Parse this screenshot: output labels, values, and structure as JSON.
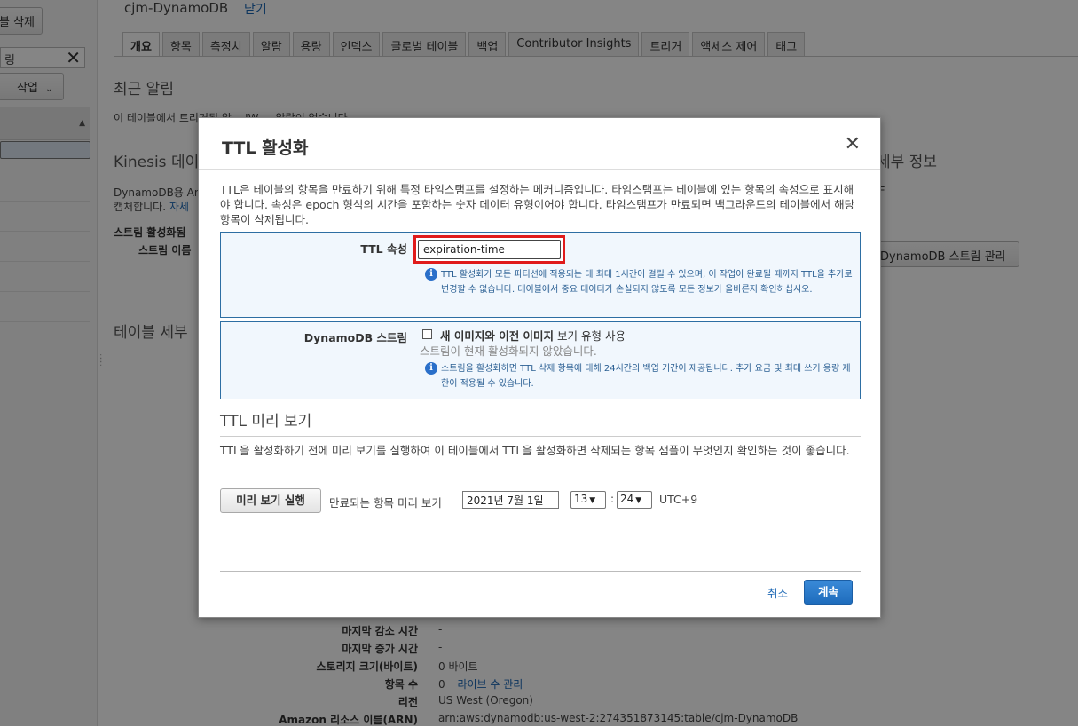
{
  "left": {
    "delete_button": "블 삭제",
    "search_value": "링",
    "actions_button": "작업"
  },
  "main": {
    "table_name": "cjm-DynamoDB",
    "close_link": "닫기",
    "tabs": [
      "개요",
      "항목",
      "측정치",
      "알람",
      "용량",
      "인덱스",
      "글로벌 테이블",
      "백업",
      "Contributor Insights",
      "트리거",
      "액세스 제어",
      "태그"
    ],
    "recent_alarms_heading": "최근 알림",
    "recent_alarms_text": "이 테이블에서 트리거된 알... JW ... 알람이 없습니다.",
    "kinesis_heading": "Kinesis 데이",
    "kinesis_text_1": "DynamoDB용 An",
    "kinesis_text_2": "캡처합니다.",
    "kinesis_link": "자세",
    "stream_label_1": "스트림 활성화됨",
    "stream_label_2": "스트림 이름",
    "details_heading_right": "세부 정보",
    "details_text_right": "E",
    "manage_stream_button": "DynamoDB 스트림 관리",
    "table_details_heading": "테이블 세부",
    "details_rows": [
      {
        "label": "마지막 감소 시간",
        "value": "-"
      },
      {
        "label": "마지막 증가 시간",
        "value": "-"
      },
      {
        "label": "스토리지 크기(바이트)",
        "value": "0 바이트"
      },
      {
        "label": "항목 수",
        "value": "0",
        "link": "라이브 수 관리"
      },
      {
        "label": "리전",
        "value": "US West (Oregon)"
      },
      {
        "label": "Amazon 리소스 이름(ARN)",
        "value": "arn:aws:dynamodb:us-west-2:274351873145:table/cjm-DynamoDB"
      }
    ]
  },
  "modal": {
    "title": "TTL 활성화",
    "description": "TTL은 테이블의 항목을 만료하기 위해 특정 타임스탬프를 설정하는 메커니즘입니다. 타임스탬프는 테이블에 있는 항목의 속성으로 표시해야 합니다. 속성은 epoch 형식의 시간을 포함하는 숫자 데이터 유형이어야 합니다. 타임스탬프가 만료되면 백그라운드의 테이블에서 해당 항목이 삭제됩니다.",
    "ttl_attribute_label": "TTL 속성",
    "ttl_attribute_value": "expiration-time",
    "ttl_info": "TTL 활성화가 모든 파티션에 적용되는 데 최대 1시간이 걸릴 수 있으며, 이 작업이 완료될 때까지 TTL을 추가로 변경할 수 없습니다. 테이블에서 중요 데이터가 손실되지 않도록 모든 정보가 올바른지 확인하십시오.",
    "stream_label": "DynamoDB 스트림",
    "stream_checkbox_bold": "새 이미지와 이전 이미지",
    "stream_checkbox_rest": "보기 유형 사용",
    "stream_status": "스트림이 현재 활성화되지 않았습니다.",
    "stream_info": "스트림을 활성화하면 TTL 삭제 항목에 대해 24시간의 백업 기간이 제공됩니다. 추가 요금 및 최대 쓰기 용량 제한이 적용될 수 있습니다.",
    "preview_heading": "TTL 미리 보기",
    "preview_description": "TTL을 활성화하기 전에 미리 보기를 실행하여 이 테이블에서 TTL을 활성화하면 삭제되는 항목 샘플이 무엇인지 확인하는 것이 좋습니다.",
    "run_preview_button": "미리 보기 실행",
    "expire_label": "만료되는 항목 미리 보기",
    "date_value": "2021년 7월 1일",
    "hour_value": "13",
    "minute_value": "24",
    "timezone": "UTC+9",
    "cancel": "취소",
    "continue": "계속"
  }
}
